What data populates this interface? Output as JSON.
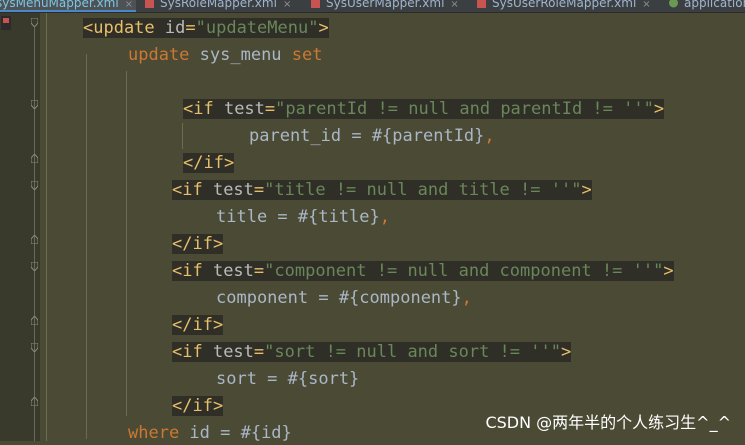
{
  "tabs": [
    {
      "label": "sysMenuMapper.xml",
      "close": "×",
      "active": true
    },
    {
      "label": "SysRoleMapper.xml",
      "close": "×",
      "active": false
    },
    {
      "label": "SysUserMapper.xml",
      "close": "×",
      "active": false
    },
    {
      "label": "SysUserRoleMapper.xml",
      "close": "×",
      "active": false
    },
    {
      "label": "application",
      "close": "",
      "active": false
    }
  ],
  "code": {
    "l1": {
      "open": "<update ",
      "attr": "id",
      "eq": "=",
      "val": "\"updateMenu\"",
      "close": ">"
    },
    "l2": {
      "kw1": "update",
      "txt": " sys_menu ",
      "kw2": "set"
    },
    "l4": {
      "open": "<if ",
      "attr": "test",
      "eq": "=",
      "val": "\"parentId != null and parentId != ''\"",
      "close": ">"
    },
    "l5": {
      "txt": "parent_id = #{parentId}",
      "comma": ","
    },
    "l6": {
      "end": "</if>"
    },
    "l7": {
      "open": "<if ",
      "attr": "test",
      "eq": "=",
      "val": "\"title != null and title != ''\"",
      "close": ">"
    },
    "l8": {
      "txt": "title = #{title}",
      "comma": ","
    },
    "l9": {
      "end": "</if>"
    },
    "l10": {
      "open": "<if ",
      "attr": "test",
      "eq": "=",
      "val": "\"component != null and component != ''\"",
      "close": ">"
    },
    "l11": {
      "txt": "component = #{component}",
      "comma": ","
    },
    "l12": {
      "end": "</if>"
    },
    "l13": {
      "open": "<if ",
      "attr": "test",
      "eq": "=",
      "val": "\"sort != null and sort != ''\"",
      "close": ">"
    },
    "l14": {
      "txt": "sort = #{sort}"
    },
    "l15": {
      "end": "</if>"
    },
    "l16": {
      "kw": "where",
      "txt": " id = #{id}"
    }
  },
  "watermark": "CSDN @两年半的个人练习生^_^",
  "colors": {
    "background": "#4b4a35",
    "tag": "#e8bf6a",
    "string": "#6a8759",
    "keyword": "#cc7832",
    "text": "#a9b7c6"
  }
}
